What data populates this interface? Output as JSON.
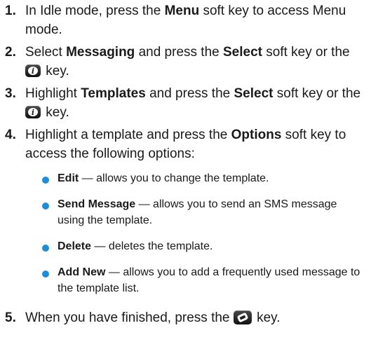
{
  "steps": [
    {
      "num": "1.",
      "lines": [
        [
          "In Idle mode, press the ",
          "Menu",
          " soft key to access Menu"
        ],
        [
          "mode."
        ]
      ]
    },
    {
      "num": "2.",
      "lines": [
        [
          "Select ",
          "Messaging",
          " and press the ",
          "Select",
          " soft key or the"
        ],
        [
          "key."
        ]
      ]
    },
    {
      "num": "3.",
      "lines": [
        [
          "Highlight ",
          "Templates",
          " and press the ",
          "Select",
          " soft key or the"
        ],
        [
          "key."
        ]
      ]
    },
    {
      "num": "4.",
      "lines": [
        [
          "Highlight a template and press the ",
          "Options",
          " soft key to"
        ],
        [
          "access the following options:"
        ]
      ]
    },
    {
      "num": "5.",
      "lines": [
        [
          "When you have finished, press the",
          "key."
        ]
      ]
    }
  ],
  "options": [
    {
      "term": "Edit",
      "desc1": " — allows you to change the template.",
      "desc2": ""
    },
    {
      "term": "Send Message",
      "desc1": " — allows you to send an SMS message",
      "desc2": "using the template."
    },
    {
      "term": "Delete",
      "desc1": " — deletes the template.",
      "desc2": ""
    },
    {
      "term": "Add New",
      "desc1": " — allows you to add a frequently used message to",
      "desc2": "the template list."
    }
  ],
  "icons": {
    "ok_key": "info-ok-key-icon",
    "end_key": "end-key-icon"
  },
  "colors": {
    "bullet": "#1f8dd6"
  }
}
